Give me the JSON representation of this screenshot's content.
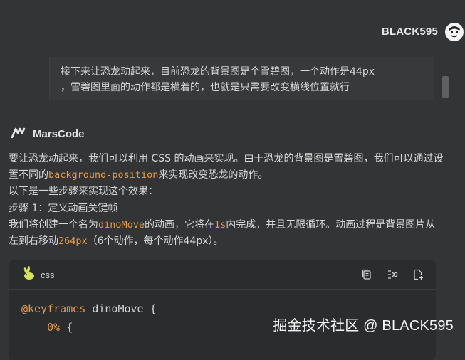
{
  "user": {
    "name": "BLACK595",
    "avatar_icon": "face-avatar-icon",
    "message_line1": "接下来让恐龙动起来，目前恐龙的背景图是个雪碧图，一个动作是44px",
    "message_line2": "，雪碧图里面的动作都是横着的，也就是只需要改变横线位置就行"
  },
  "assistant": {
    "name": "MarsCode",
    "logo_icon": "marscode-logo-icon",
    "para1_a": "要让恐龙动起来，我们可以利用 CSS 的动画来实现。由于恐龙的背景图是雪碧图，我们可以通过设置不同的",
    "para1_code": "background-position",
    "para1_b": "来实现改变恐龙的动作。",
    "line2": "以下是一些步骤来实现这个效果：",
    "line3": "步骤 1：定义动画关键帧",
    "para4_a": "我们将创建一个名为",
    "para4_code1": "dinoMove",
    "para4_b": "的动画，它将在",
    "para4_code2": "1s",
    "para4_c": "内完成，并且无限循环。动画过程是背景图片从左到右移动",
    "para4_code3": "264px",
    "para4_d": "（6个动作，每个动作44px）。"
  },
  "code_block": {
    "language": "css",
    "language_icon": "rabbit-icon",
    "actions": [
      "copy-icon",
      "insert-icon",
      "new-file-icon"
    ],
    "line1_at": "@keyframes",
    "line1_name": " dinoMove {",
    "line2_sel": "0%",
    "line2_rest": " {"
  },
  "watermark": "掘金技术社区 @ BLACK595"
}
